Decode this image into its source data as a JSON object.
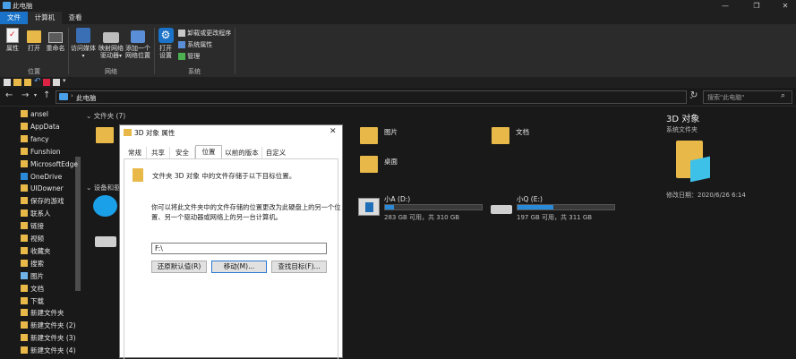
{
  "window": {
    "title": "此电脑",
    "minimize": "—",
    "maximize": "❐",
    "close": "✕"
  },
  "menu_tabs": [
    "文件",
    "计算机",
    "查看"
  ],
  "ribbon": {
    "buttons": {
      "properties": "属性",
      "open": "打开",
      "rename": "重命名",
      "access_media": "访问媒体",
      "map_drive_1": "映射网络",
      "map_drive_2": "驱动器",
      "add_network_1": "添加一个",
      "add_network_2": "网络位置",
      "open_settings_1": "打开",
      "open_settings_2": "设置",
      "uninstall": "卸载或更改程序",
      "system_props": "系统属性",
      "manage": "管理"
    },
    "groups": {
      "location": "位置",
      "network": "网络",
      "system": "系统"
    }
  },
  "address": {
    "path": "此电脑",
    "search_placeholder": "搜索\"此电脑\""
  },
  "nav": [
    "ansel",
    "AppData",
    "fancy",
    "Funshion",
    "MicrosoftEdge",
    "OneDrive",
    "UIDowner",
    "保存的游戏",
    "联系人",
    "链接",
    "视频",
    "收藏夹",
    "搜索",
    "图片",
    "文档",
    "下载",
    "新建文件夹",
    "新建文件夹 (2)",
    "新建文件夹 (3)",
    "新建文件夹 (4)"
  ],
  "content": {
    "folders_header": "文件夹 (7)",
    "devices_header": "设备和驱动器",
    "folders": [
      "图片",
      "文档",
      "桌面"
    ],
    "drives": [
      {
        "name": "小A (D:)",
        "free": "283 GB 可用，共 310 GB",
        "used_fraction": 0.09
      },
      {
        "name": "小Q (E:)",
        "free": "197 GB 可用，共 311 GB",
        "used_fraction": 0.37
      }
    ]
  },
  "details": {
    "title": "3D 对象",
    "subtitle": "系统文件夹",
    "modified": "修改日期：2020/6/26 6:14"
  },
  "dialog": {
    "title": "3D 对象 属性",
    "close": "✕",
    "tabs": [
      "常规",
      "共享",
      "安全",
      "位置",
      "以前的版本",
      "自定义"
    ],
    "desc": "文件夹 3D 对象 中的文件存储于以下目标位置。",
    "info_line1": "你可以将此文件夹中的文件存储的位置更改为此硬盘上的另一个位",
    "info_line2": "置、另一个驱动器或网络上的另一台计算机。",
    "path_value": "F:\\",
    "btn_restore": "还原默认值(R)",
    "btn_move": "移动(M)...",
    "btn_find": "查找目标(F)..."
  }
}
